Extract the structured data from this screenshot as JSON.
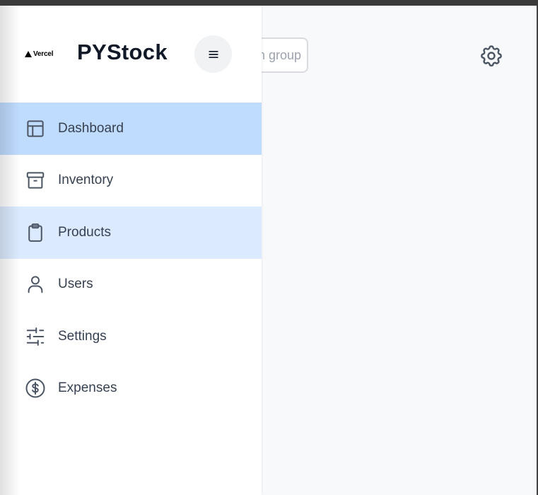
{
  "app": {
    "title": "PYStock",
    "logo_text": "Vercel"
  },
  "header": {
    "search_value": "Search group",
    "settings_icon": "gear-icon"
  },
  "sidebar": {
    "menu_icon": "hamburger-icon",
    "items": [
      {
        "label": "Dashboard",
        "icon": "layout-icon",
        "state": "active"
      },
      {
        "label": "Inventory",
        "icon": "archive-icon",
        "state": "normal"
      },
      {
        "label": "Products",
        "icon": "clipboard-icon",
        "state": "hover"
      },
      {
        "label": "Users",
        "icon": "user-icon",
        "state": "normal"
      },
      {
        "label": "Settings",
        "icon": "sliders-icon",
        "state": "normal"
      },
      {
        "label": "Expenses",
        "icon": "dollar-circle-icon",
        "state": "normal"
      }
    ]
  },
  "colors": {
    "active_bg": "#bfdbfe",
    "hover_bg": "#dbeafe",
    "text": "#374151",
    "title": "#111827",
    "icon": "#4b5563"
  }
}
